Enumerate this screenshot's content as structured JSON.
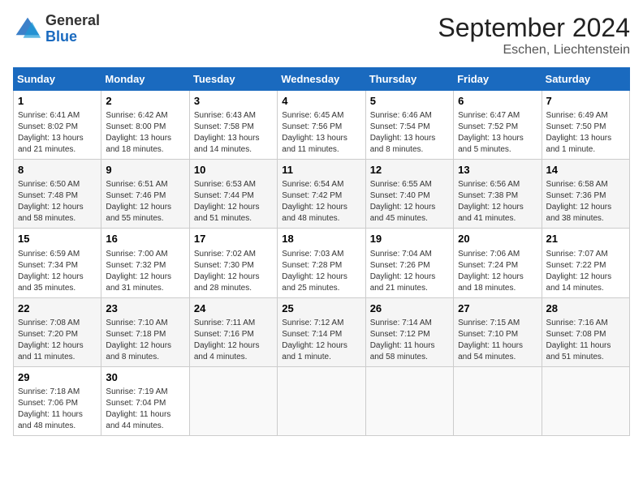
{
  "header": {
    "logo_general": "General",
    "logo_blue": "Blue",
    "month_title": "September 2024",
    "location": "Eschen, Liechtenstein"
  },
  "days_of_week": [
    "Sunday",
    "Monday",
    "Tuesday",
    "Wednesday",
    "Thursday",
    "Friday",
    "Saturday"
  ],
  "weeks": [
    [
      {
        "day": "1",
        "sunrise": "6:41 AM",
        "sunset": "8:02 PM",
        "daylight": "13 hours and 21 minutes."
      },
      {
        "day": "2",
        "sunrise": "6:42 AM",
        "sunset": "8:00 PM",
        "daylight": "13 hours and 18 minutes."
      },
      {
        "day": "3",
        "sunrise": "6:43 AM",
        "sunset": "7:58 PM",
        "daylight": "13 hours and 14 minutes."
      },
      {
        "day": "4",
        "sunrise": "6:45 AM",
        "sunset": "7:56 PM",
        "daylight": "13 hours and 11 minutes."
      },
      {
        "day": "5",
        "sunrise": "6:46 AM",
        "sunset": "7:54 PM",
        "daylight": "13 hours and 8 minutes."
      },
      {
        "day": "6",
        "sunrise": "6:47 AM",
        "sunset": "7:52 PM",
        "daylight": "13 hours and 5 minutes."
      },
      {
        "day": "7",
        "sunrise": "6:49 AM",
        "sunset": "7:50 PM",
        "daylight": "13 hours and 1 minute."
      }
    ],
    [
      {
        "day": "8",
        "sunrise": "6:50 AM",
        "sunset": "7:48 PM",
        "daylight": "12 hours and 58 minutes."
      },
      {
        "day": "9",
        "sunrise": "6:51 AM",
        "sunset": "7:46 PM",
        "daylight": "12 hours and 55 minutes."
      },
      {
        "day": "10",
        "sunrise": "6:53 AM",
        "sunset": "7:44 PM",
        "daylight": "12 hours and 51 minutes."
      },
      {
        "day": "11",
        "sunrise": "6:54 AM",
        "sunset": "7:42 PM",
        "daylight": "12 hours and 48 minutes."
      },
      {
        "day": "12",
        "sunrise": "6:55 AM",
        "sunset": "7:40 PM",
        "daylight": "12 hours and 45 minutes."
      },
      {
        "day": "13",
        "sunrise": "6:56 AM",
        "sunset": "7:38 PM",
        "daylight": "12 hours and 41 minutes."
      },
      {
        "day": "14",
        "sunrise": "6:58 AM",
        "sunset": "7:36 PM",
        "daylight": "12 hours and 38 minutes."
      }
    ],
    [
      {
        "day": "15",
        "sunrise": "6:59 AM",
        "sunset": "7:34 PM",
        "daylight": "12 hours and 35 minutes."
      },
      {
        "day": "16",
        "sunrise": "7:00 AM",
        "sunset": "7:32 PM",
        "daylight": "12 hours and 31 minutes."
      },
      {
        "day": "17",
        "sunrise": "7:02 AM",
        "sunset": "7:30 PM",
        "daylight": "12 hours and 28 minutes."
      },
      {
        "day": "18",
        "sunrise": "7:03 AM",
        "sunset": "7:28 PM",
        "daylight": "12 hours and 25 minutes."
      },
      {
        "day": "19",
        "sunrise": "7:04 AM",
        "sunset": "7:26 PM",
        "daylight": "12 hours and 21 minutes."
      },
      {
        "day": "20",
        "sunrise": "7:06 AM",
        "sunset": "7:24 PM",
        "daylight": "12 hours and 18 minutes."
      },
      {
        "day": "21",
        "sunrise": "7:07 AM",
        "sunset": "7:22 PM",
        "daylight": "12 hours and 14 minutes."
      }
    ],
    [
      {
        "day": "22",
        "sunrise": "7:08 AM",
        "sunset": "7:20 PM",
        "daylight": "12 hours and 11 minutes."
      },
      {
        "day": "23",
        "sunrise": "7:10 AM",
        "sunset": "7:18 PM",
        "daylight": "12 hours and 8 minutes."
      },
      {
        "day": "24",
        "sunrise": "7:11 AM",
        "sunset": "7:16 PM",
        "daylight": "12 hours and 4 minutes."
      },
      {
        "day": "25",
        "sunrise": "7:12 AM",
        "sunset": "7:14 PM",
        "daylight": "12 hours and 1 minute."
      },
      {
        "day": "26",
        "sunrise": "7:14 AM",
        "sunset": "7:12 PM",
        "daylight": "11 hours and 58 minutes."
      },
      {
        "day": "27",
        "sunrise": "7:15 AM",
        "sunset": "7:10 PM",
        "daylight": "11 hours and 54 minutes."
      },
      {
        "day": "28",
        "sunrise": "7:16 AM",
        "sunset": "7:08 PM",
        "daylight": "11 hours and 51 minutes."
      }
    ],
    [
      {
        "day": "29",
        "sunrise": "7:18 AM",
        "sunset": "7:06 PM",
        "daylight": "11 hours and 48 minutes."
      },
      {
        "day": "30",
        "sunrise": "7:19 AM",
        "sunset": "7:04 PM",
        "daylight": "11 hours and 44 minutes."
      },
      null,
      null,
      null,
      null,
      null
    ]
  ],
  "labels": {
    "sunrise": "Sunrise: ",
    "sunset": "Sunset: ",
    "daylight": "Daylight: "
  }
}
